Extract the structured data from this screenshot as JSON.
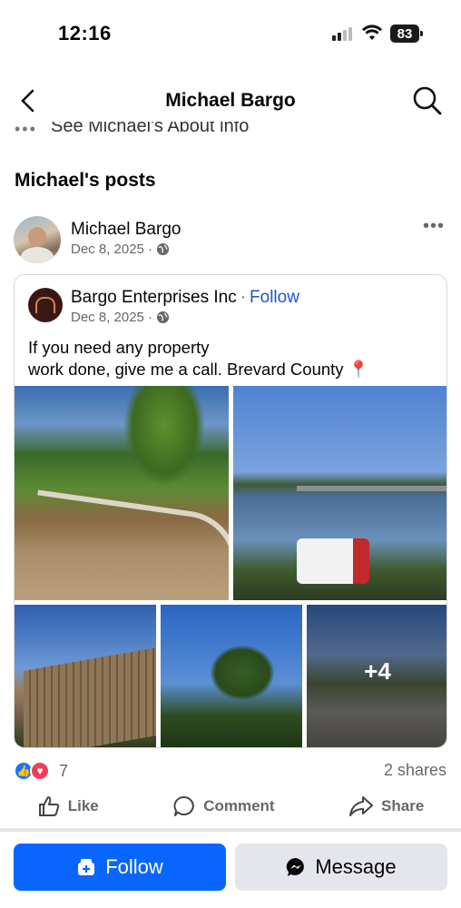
{
  "status": {
    "time": "12:16",
    "battery": "83"
  },
  "nav": {
    "title": "Michael Bargo"
  },
  "about": {
    "text": "See Michael's About info"
  },
  "section": {
    "title": "Michael's posts"
  },
  "post": {
    "author": "Michael Bargo",
    "date": "Dec 8, 2025 ·",
    "shared": {
      "org": "Bargo Enterprises Inc",
      "separator": "·",
      "follow": "Follow",
      "date": "Dec 8, 2025 ·",
      "text_line1": "If you need any property",
      "text_line2": "work done, give me a call. Brevard County",
      "pin": "📍",
      "more_photos": "+4"
    },
    "reactions_count": "7",
    "shares": "2 shares",
    "actions": {
      "like": "Like",
      "comment": "Comment",
      "share": "Share"
    }
  },
  "bottom": {
    "follow": "Follow",
    "message": "Message"
  },
  "colors": {
    "accent": "#0866ff",
    "link": "#1c56c6",
    "muted": "#65676b"
  }
}
